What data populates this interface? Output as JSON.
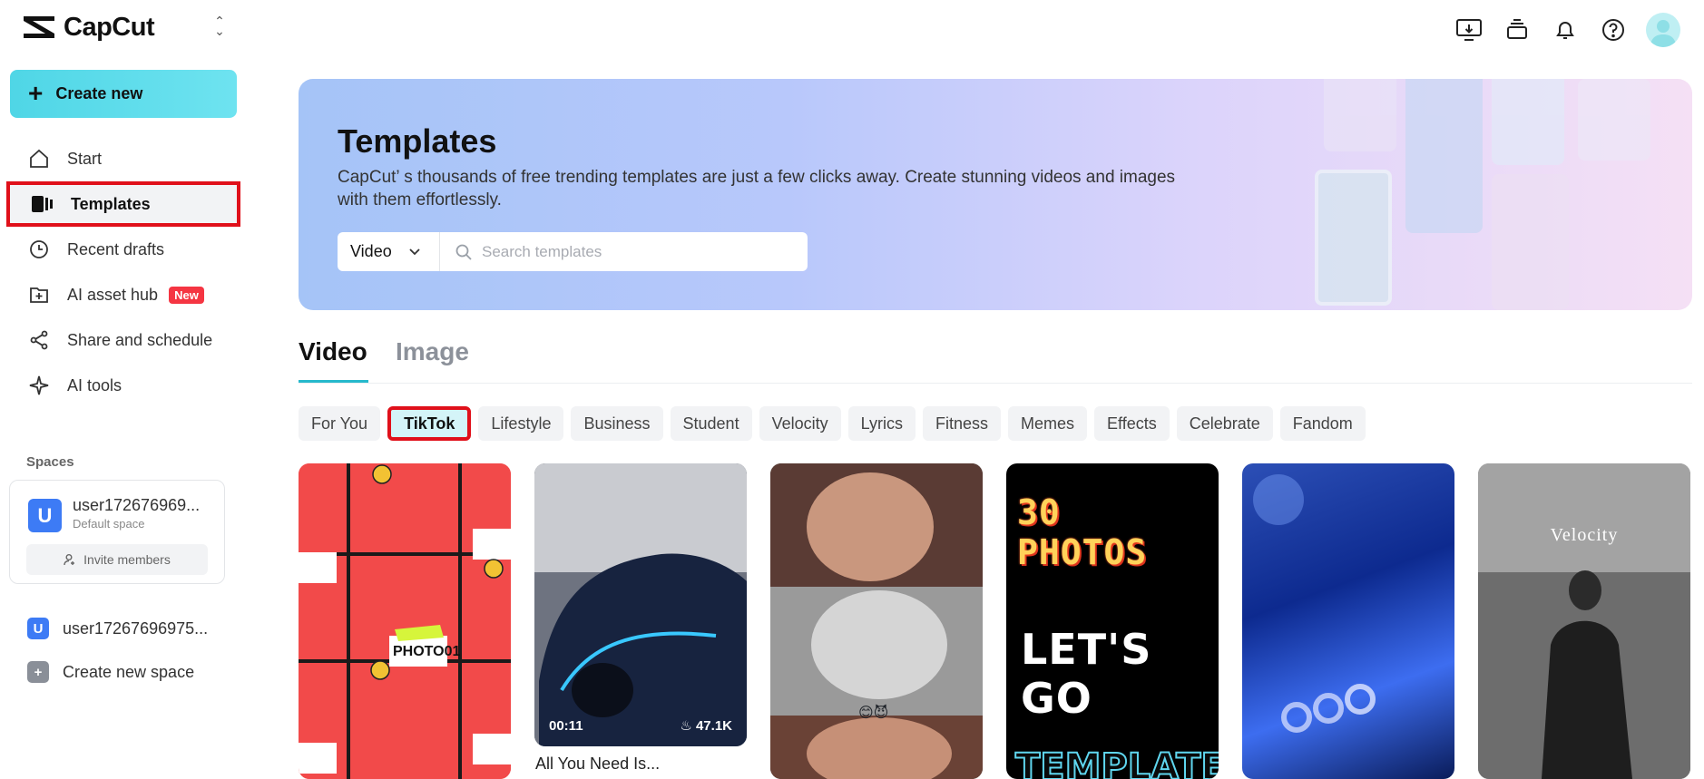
{
  "app": {
    "name": "CapCut"
  },
  "sidebar": {
    "create_label": "Create new",
    "items": [
      {
        "label": "Start",
        "icon": "home-icon"
      },
      {
        "label": "Templates",
        "icon": "templates-icon"
      },
      {
        "label": "Recent drafts",
        "icon": "clock-icon"
      },
      {
        "label": "AI asset hub",
        "icon": "asset-hub-icon",
        "badge": "New"
      },
      {
        "label": "Share and schedule",
        "icon": "share-icon"
      },
      {
        "label": "AI tools",
        "icon": "sparkle-icon"
      }
    ],
    "spaces_title": "Spaces",
    "space_card": {
      "avatar": "U",
      "name": "user172676969...",
      "sub": "Default space",
      "invite_label": "Invite members"
    },
    "space_rows": [
      {
        "avatar": "U",
        "label": "user17267696975..."
      },
      {
        "avatar": "+",
        "label": "Create new space"
      }
    ]
  },
  "banner": {
    "title": "Templates",
    "description": "CapCut’ s thousands of free trending templates are just a few clicks away. Create stunning videos and images with them effortlessly.",
    "select_value": "Video",
    "search_placeholder": "Search templates"
  },
  "tabs": [
    {
      "label": "Video",
      "active": true
    },
    {
      "label": "Image",
      "active": false
    }
  ],
  "chips": [
    "For You",
    "TikTok",
    "Lifestyle",
    "Business",
    "Student",
    "Velocity",
    "Lyrics",
    "Fitness",
    "Memes",
    "Effects",
    "Celebrate",
    "Fandom"
  ],
  "selected_chip": "TikTok",
  "cards": [
    {
      "overlay_text": "PHOTO01"
    },
    {
      "duration": "00:11",
      "likes": "47.1K",
      "title": "All You Need Is..."
    },
    {
      "overlay_text": "😊😈"
    },
    {
      "line1": "30 PHOTOS",
      "line2": "LET'S GO",
      "line3": "TEMPLATE"
    },
    {
      "overlay_text": ""
    },
    {
      "overlay_text": "Velocity"
    }
  ],
  "colors": {
    "accent": "#26b9cc",
    "highlight_border": "#e0101a",
    "badge": "#f53542"
  }
}
